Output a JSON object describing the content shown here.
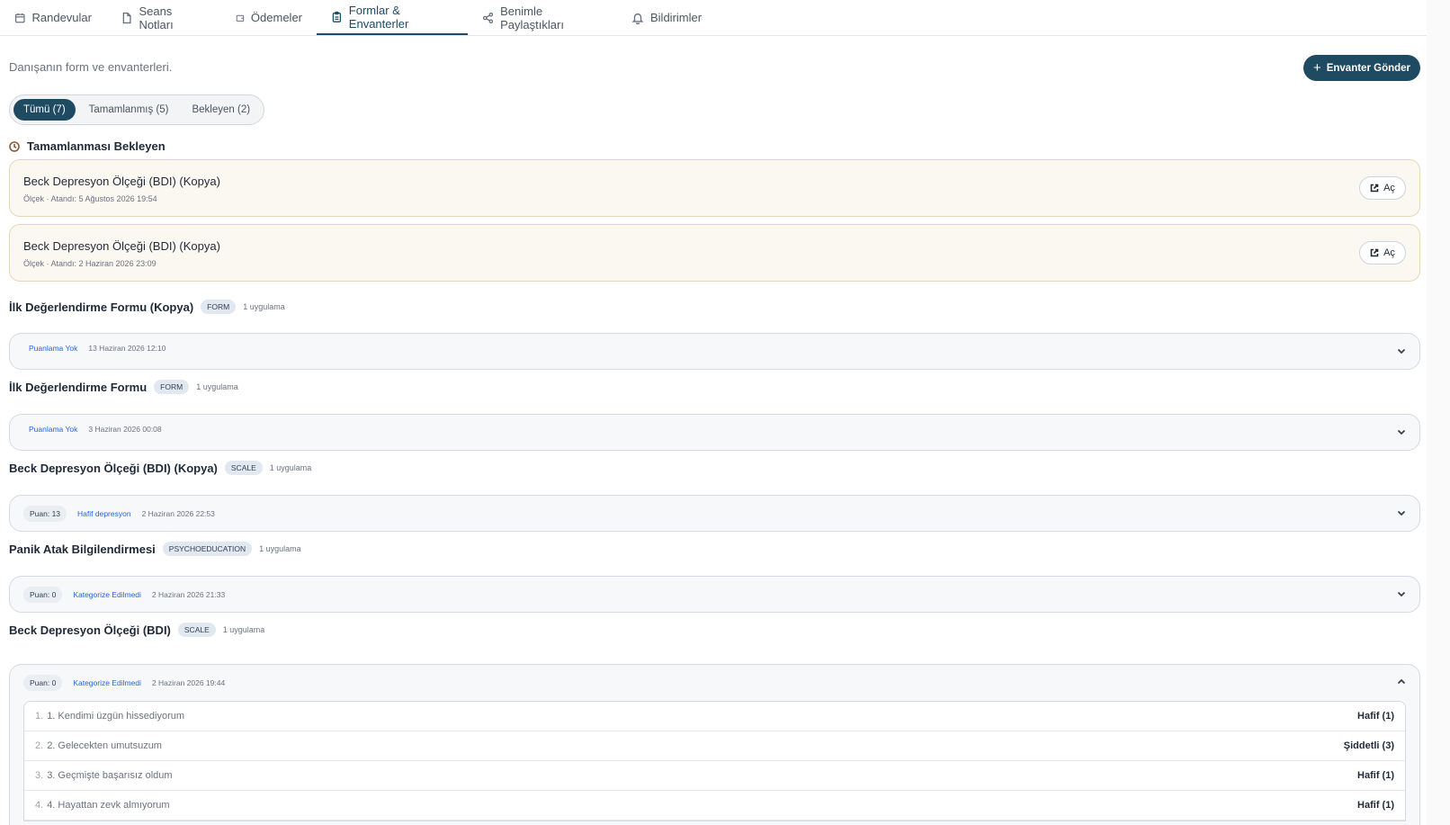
{
  "tabs": [
    {
      "label": "Randevular",
      "icon": "calendar-icon"
    },
    {
      "label": "Seans Notları",
      "icon": "document-icon"
    },
    {
      "label": "Ödemeler",
      "icon": "wallet-icon"
    },
    {
      "label": "Formlar & Envanterler",
      "icon": "clipboard-icon",
      "active": true
    },
    {
      "label": "Benimle Paylaştıkları",
      "icon": "share-icon"
    },
    {
      "label": "Bildirimler",
      "icon": "bell-icon"
    }
  ],
  "subtitle": "Danışanın form ve envanterleri.",
  "send_button": "Envanter Gönder",
  "filters": [
    {
      "label": "Tümü (7)",
      "active": true
    },
    {
      "label": "Tamamlanmış (5)"
    },
    {
      "label": "Bekleyen (2)"
    }
  ],
  "pending_section": {
    "title": "Tamamlanması Bekleyen",
    "items": [
      {
        "title": "Beck Depresyon Ölçeği (BDI) (Kopya)",
        "meta": "Ölçek · Atandı: 5 Ağustos 2026 19:54",
        "button": "Aç"
      },
      {
        "title": "Beck Depresyon Ölçeği (BDI) (Kopya)",
        "meta": "Ölçek · Atandı: 2 Haziran 2026 23:09",
        "button": "Aç"
      }
    ]
  },
  "forms": [
    {
      "title": "İlk Değerlendirme Formu (Kopya)",
      "type": "FORM",
      "uses": "1 uygulama",
      "score": "",
      "category": "Puanlama Yok",
      "date": "13 Haziran 2026 12:10"
    },
    {
      "title": "İlk Değerlendirme Formu",
      "type": "FORM",
      "uses": "1 uygulama",
      "score": "",
      "category": "Puanlama Yok",
      "date": "3 Haziran 2026 00:08"
    },
    {
      "title": "Beck Depresyon Ölçeği (BDI) (Kopya)",
      "type": "SCALE",
      "uses": "1 uygulama",
      "score": "Puan: 13",
      "category": "Hafif depresyon",
      "date": "2 Haziran 2026 22:53"
    },
    {
      "title": "Panik Atak Bilgilendirmesi",
      "type": "PSYCHOEDUCATION",
      "uses": "1 uygulama",
      "score": "Puan: 0",
      "category": "Kategorize Edilmedi",
      "date": "2 Haziran 2026 21:33"
    }
  ],
  "expanded_form": {
    "title": "Beck Depresyon Ölçeği (BDI)",
    "type": "SCALE",
    "uses": "1 uygulama",
    "score": "Puan: 0",
    "category": "Kategorize Edilmedi",
    "date": "2 Haziran 2026 19:44",
    "answers": [
      {
        "num": "1.",
        "question": "1. Kendimi üzgün hissediyorum",
        "answer": "Hafif (1)"
      },
      {
        "num": "2.",
        "question": "2. Gelecekten umutsuzum",
        "answer": "Şiddetli (3)"
      },
      {
        "num": "3.",
        "question": "3. Geçmişte başarısız oldum",
        "answer": "Hafif (1)"
      },
      {
        "num": "4.",
        "question": "4. Hayattan zevk almıyorum",
        "answer": "Hafif (1)"
      }
    ]
  }
}
